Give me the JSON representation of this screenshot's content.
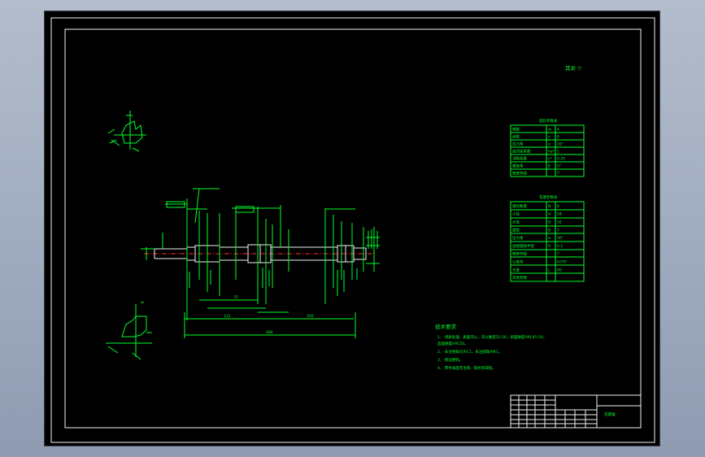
{
  "surface_finish_note": "其余 ▽",
  "parameter_table_1": {
    "title": "齿轮参数表",
    "rows": [
      [
        "模数",
        "m",
        "4"
      ],
      [
        "齿数",
        "z",
        "6"
      ],
      [
        "压力角",
        "α",
        "20°"
      ],
      [
        "齿顶高系数",
        "ha*",
        "1"
      ],
      [
        "顶隙系数",
        "c*",
        "0.25"
      ],
      [
        "螺旋角",
        "β",
        "0°"
      ],
      [
        "精度等级",
        "",
        "7"
      ]
    ]
  },
  "parameter_table_2": {
    "title": "花键参数表",
    "rows": [
      [
        "键的数量",
        "N",
        "6"
      ],
      [
        "小径",
        "d",
        "28"
      ],
      [
        "大径",
        "D",
        "32"
      ],
      [
        "键宽",
        "B",
        "7"
      ],
      [
        "压力角",
        "α",
        "30°"
      ],
      [
        "齿根圆角半径",
        "R",
        "0.2"
      ],
      [
        "精度等级",
        "",
        "7"
      ],
      [
        "公差带",
        "",
        "H7/f7"
      ],
      [
        "长度",
        "L",
        "40"
      ],
      [
        "其他参数",
        "",
        ""
      ]
    ]
  },
  "technical_requirements": {
    "title": "技术要求",
    "items": [
      "1、 调质处理，表面淬火，淬火硬度52-56，表面硬度HRC45-50，",
      "   齿面硬度HRC50。",
      "2、 未注倒角均为C1，未注圆角为R1。",
      "3、 锐边倒钝。",
      "4、 零件表面无毛刺、裂纹等缺陷。"
    ]
  },
  "title_block": {
    "part_name": "花键轴"
  },
  "shaft_dimensions": {
    "overall_length": "480",
    "section_length": "350",
    "left_length": "115",
    "middle_length": "75"
  }
}
